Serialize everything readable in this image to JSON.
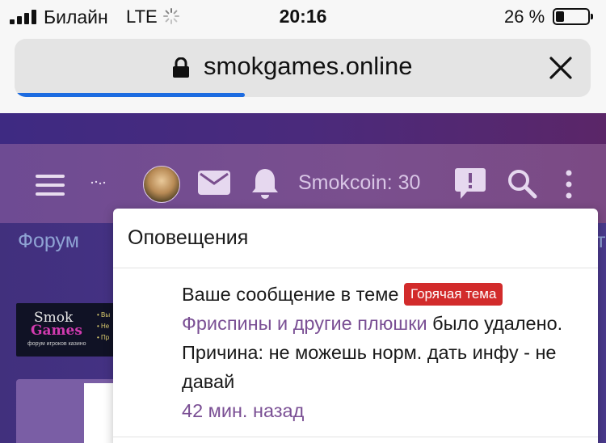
{
  "status_bar": {
    "carrier": "Билайн",
    "network": "LTE",
    "time": "20:16",
    "battery_percent": "26 %",
    "battery_level": 0.26
  },
  "browser": {
    "url": "smokgames.online",
    "load_progress": 0.4
  },
  "site_header": {
    "smokcoin": "Smokcoin: 30",
    "icons": [
      "menu-icon",
      "avatar",
      "mail-icon",
      "bell-icon",
      "chat-alert-icon",
      "search-icon",
      "more-vertical-icon"
    ]
  },
  "page": {
    "tab_forum": "Форум",
    "right_peek": "т",
    "banner": {
      "line1": "Smok",
      "line2": "Games",
      "line3": "форум игроков казино",
      "bullets": [
        "• Вы",
        "• Не",
        "• Пр"
      ]
    }
  },
  "notifications": {
    "title": "Оповещения",
    "items": [
      {
        "text_before": "Ваше сообщение в теме ",
        "badge": "Горячая тема",
        "topic": "Фриспины и другие плюшки",
        "text_after": " было удалено. Причина: не можешь норм. дать инфу - не давай",
        "time": "42 мин. назад"
      }
    ]
  },
  "colors": {
    "accent_link": "#7a4f94",
    "badge_red": "#d22b2b",
    "progress_blue": "#1c6be0"
  }
}
